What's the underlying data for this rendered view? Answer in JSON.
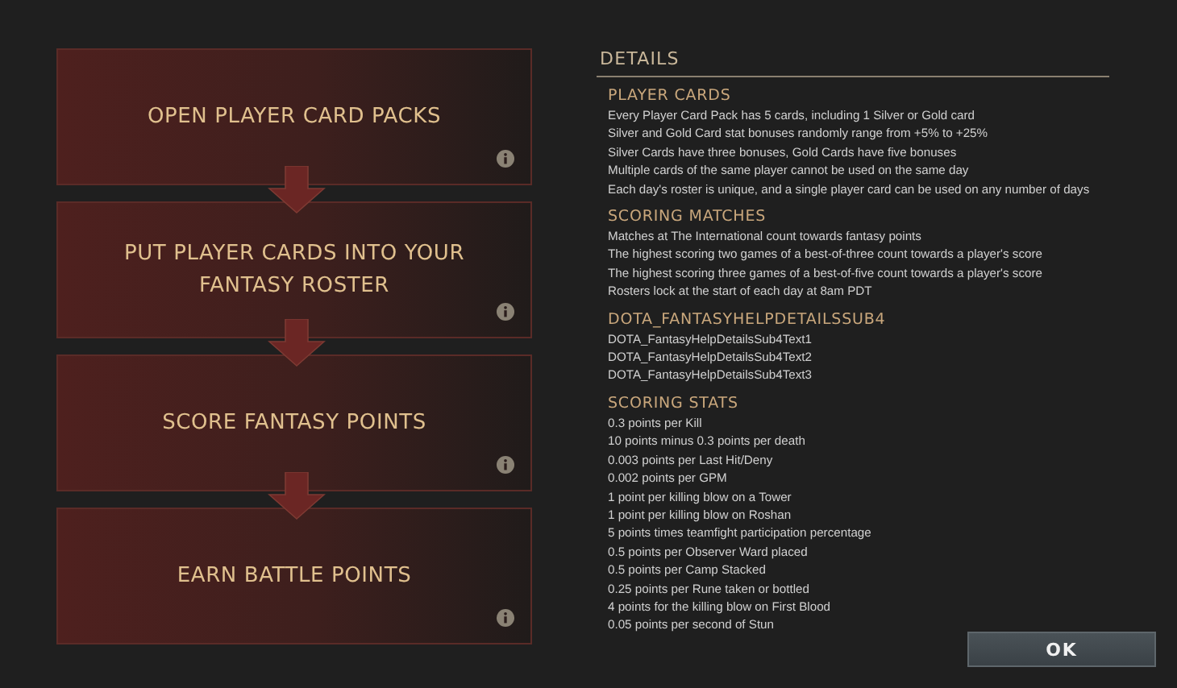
{
  "steps": [
    {
      "label": "OPEN PLAYER CARD PACKS"
    },
    {
      "label": "PUT PLAYER CARDS INTO YOUR FANTASY ROSTER"
    },
    {
      "label": "SCORE FANTASY POINTS"
    },
    {
      "label": "EARN BATTLE POINTS"
    }
  ],
  "details": {
    "title": "DETAILS",
    "sections": [
      {
        "heading": "PLAYER CARDS",
        "lines": [
          "Every Player Card Pack has 5 cards, including 1 Silver or Gold card",
          "Silver and Gold Card stat bonuses randomly range from +5% to +25%",
          "Silver Cards have three bonuses, Gold Cards have five bonuses",
          "Multiple cards of the same player cannot be used on the same day",
          "Each day's roster is unique, and a single player card can be used on any number of days"
        ]
      },
      {
        "heading": "SCORING MATCHES",
        "lines": [
          "Matches at The International count towards fantasy points",
          "The highest scoring two games of a best-of-three count towards a player's score",
          "The highest scoring three games of a best-of-five count towards a player's score",
          "Rosters lock at the start of each day at 8am PDT"
        ]
      },
      {
        "heading": "DOTA_FANTASYHELPDETAILSSUB4",
        "lines": [
          "DOTA_FantasyHelpDetailsSub4Text1",
          "DOTA_FantasyHelpDetailsSub4Text2",
          "DOTA_FantasyHelpDetailsSub4Text3"
        ]
      },
      {
        "heading": "SCORING STATS",
        "lines": [
          "0.3 points per Kill",
          "10 points minus 0.3 points per death",
          "0.003 points per Last Hit/Deny",
          "0.002 points per GPM",
          "1 point per killing blow on a Tower",
          "1 point per killing blow on Roshan",
          "5 points times teamfight participation percentage",
          "0.5 points per Observer Ward placed",
          "0.5 points per Camp Stacked",
          "0.25 points per Rune taken or bottled",
          "4 points for the killing blow on First Blood",
          "0.05 points per second of Stun"
        ]
      }
    ]
  },
  "ok_button": "OK"
}
